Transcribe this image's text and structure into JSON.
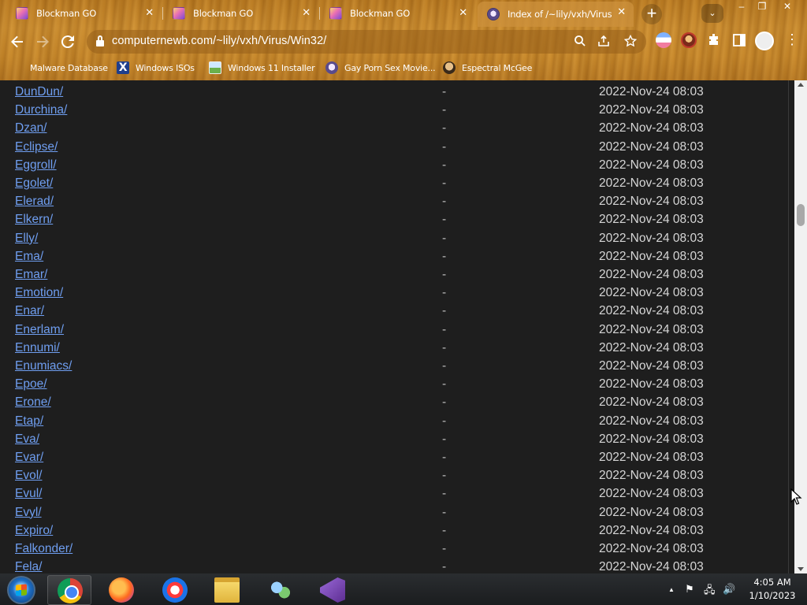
{
  "browser": {
    "tabs": [
      {
        "title": "Blockman GO",
        "active": false,
        "icon": "blockman-icon"
      },
      {
        "title": "Blockman GO",
        "active": false,
        "icon": "blockman-icon"
      },
      {
        "title": "Blockman GO",
        "active": false,
        "icon": "blockman-icon"
      },
      {
        "title": "Index of /~lily/vxh/Virus",
        "active": true,
        "icon": "index-icon"
      }
    ],
    "tab_close_glyph": "✕",
    "new_tab_glyph": "+",
    "tab_search_glyph": "⌄",
    "window_controls": [
      "–",
      "❐",
      "✕"
    ],
    "url": "computernewb.com/~lily/vxh/Virus/Win32/",
    "bookmarks": [
      {
        "label": "Malware Database"
      },
      {
        "label": "Windows ISOs"
      },
      {
        "label": "Windows 11 Installer"
      },
      {
        "label": "Gay Porn Sex Movie..."
      },
      {
        "label": "Espectral McGee"
      }
    ]
  },
  "directory_listing": {
    "rows": [
      {
        "name": "DunDun/",
        "size": "-",
        "modified": "2022-Nov-24 08:03"
      },
      {
        "name": "Durchina/",
        "size": "-",
        "modified": "2022-Nov-24 08:03"
      },
      {
        "name": "Dzan/",
        "size": "-",
        "modified": "2022-Nov-24 08:03"
      },
      {
        "name": "Eclipse/",
        "size": "-",
        "modified": "2022-Nov-24 08:03"
      },
      {
        "name": "Eggroll/",
        "size": "-",
        "modified": "2022-Nov-24 08:03"
      },
      {
        "name": "Egolet/",
        "size": "-",
        "modified": "2022-Nov-24 08:03"
      },
      {
        "name": "Elerad/",
        "size": "-",
        "modified": "2022-Nov-24 08:03"
      },
      {
        "name": "Elkern/",
        "size": "-",
        "modified": "2022-Nov-24 08:03"
      },
      {
        "name": "Elly/",
        "size": "-",
        "modified": "2022-Nov-24 08:03"
      },
      {
        "name": "Ema/",
        "size": "-",
        "modified": "2022-Nov-24 08:03"
      },
      {
        "name": "Emar/",
        "size": "-",
        "modified": "2022-Nov-24 08:03"
      },
      {
        "name": "Emotion/",
        "size": "-",
        "modified": "2022-Nov-24 08:03"
      },
      {
        "name": "Enar/",
        "size": "-",
        "modified": "2022-Nov-24 08:03"
      },
      {
        "name": "Enerlam/",
        "size": "-",
        "modified": "2022-Nov-24 08:03"
      },
      {
        "name": "Ennumi/",
        "size": "-",
        "modified": "2022-Nov-24 08:03"
      },
      {
        "name": "Enumiacs/",
        "size": "-",
        "modified": "2022-Nov-24 08:03"
      },
      {
        "name": "Epoe/",
        "size": "-",
        "modified": "2022-Nov-24 08:03"
      },
      {
        "name": "Erone/",
        "size": "-",
        "modified": "2022-Nov-24 08:03"
      },
      {
        "name": "Etap/",
        "size": "-",
        "modified": "2022-Nov-24 08:03"
      },
      {
        "name": "Eva/",
        "size": "-",
        "modified": "2022-Nov-24 08:03"
      },
      {
        "name": "Evar/",
        "size": "-",
        "modified": "2022-Nov-24 08:03"
      },
      {
        "name": "Evol/",
        "size": "-",
        "modified": "2022-Nov-24 08:03"
      },
      {
        "name": "Evul/",
        "size": "-",
        "modified": "2022-Nov-24 08:03"
      },
      {
        "name": "Evyl/",
        "size": "-",
        "modified": "2022-Nov-24 08:03"
      },
      {
        "name": "Expiro/",
        "size": "-",
        "modified": "2022-Nov-24 08:03"
      },
      {
        "name": "Falkonder/",
        "size": "-",
        "modified": "2022-Nov-24 08:03"
      },
      {
        "name": "Fela/",
        "size": "-",
        "modified": "2022-Nov-24 08:03"
      }
    ]
  },
  "taskbar": {
    "apps": [
      {
        "name": "chrome",
        "open": true
      },
      {
        "name": "firefox",
        "open": false
      },
      {
        "name": "opera",
        "open": false
      },
      {
        "name": "file-explorer",
        "open": false
      },
      {
        "name": "network",
        "open": false
      },
      {
        "name": "visual-studio",
        "open": false
      }
    ],
    "tray_glyphs": {
      "show_hidden": "▲",
      "flag": "⚑",
      "network": "🖧",
      "volume": "🔊"
    },
    "clock": {
      "time": "4:05 AM",
      "date": "1/10/2023"
    }
  },
  "colors": {
    "link": "#6f9ef0",
    "page_bg": "#1e1e1e",
    "date_text": "#d6d6d6"
  }
}
